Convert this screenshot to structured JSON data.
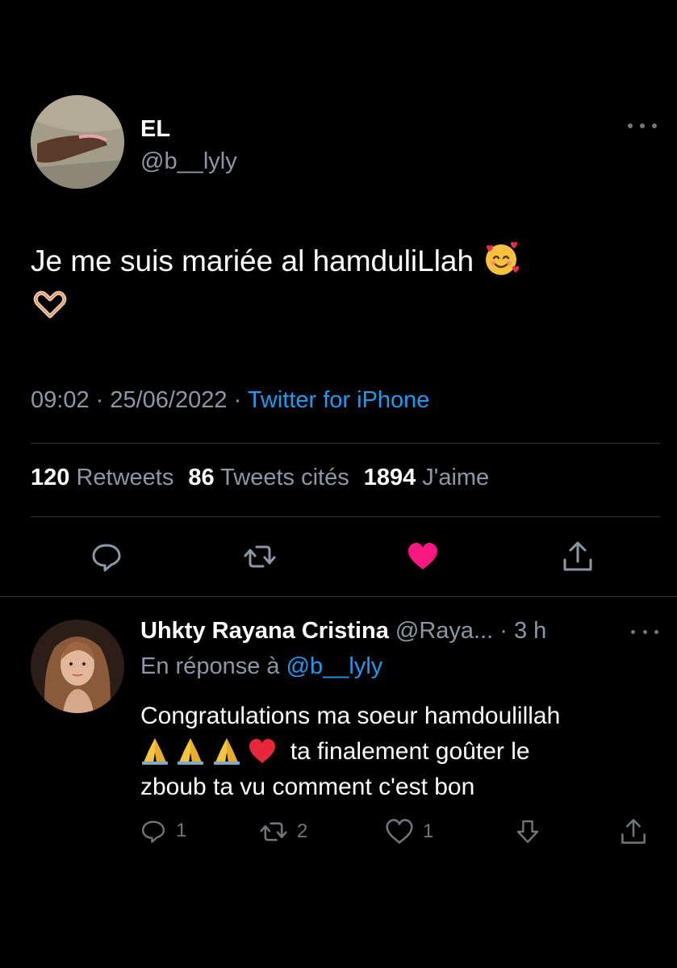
{
  "tweet": {
    "author_name": "EL",
    "author_handle": "@b__lyly",
    "text": "Je me suis mariée al hamduliLlah",
    "emojis": [
      "smiling-face-with-hearts",
      "heart-hands"
    ],
    "time": "09:02",
    "date": "25/06/2022",
    "separator": " · ",
    "source": "Twitter for iPhone",
    "stats": {
      "retweets_count": "120",
      "retweets_label": "Retweets",
      "quotes_count": "86",
      "quotes_label": "Tweets cités",
      "likes_count": "1894",
      "likes_label": "J'aime"
    },
    "liked": true
  },
  "reply": {
    "author_name": "Uhkty Rayana Cristina",
    "author_handle": "@Raya...",
    "time_ago": "3 h",
    "separator": " · ",
    "reply_prefix": "En réponse à ",
    "reply_to": "@b__lyly",
    "text_line1": "Congratulations ma soeur hamdoulillah",
    "text_line2": "ta finalement goûter le",
    "text_line3": "zboub ta vu comment c'est bon",
    "emojis": [
      "folded-hands",
      "folded-hands",
      "folded-hands",
      "red-heart"
    ],
    "actions": {
      "reply_count": "1",
      "retweet_count": "2",
      "like_count": "1"
    }
  },
  "colors": {
    "background": "#000000",
    "text": "#ffffff",
    "muted": "#8b98a5",
    "link": "#1d9bf0",
    "like": "#f91880",
    "divider": "#2f3336"
  }
}
